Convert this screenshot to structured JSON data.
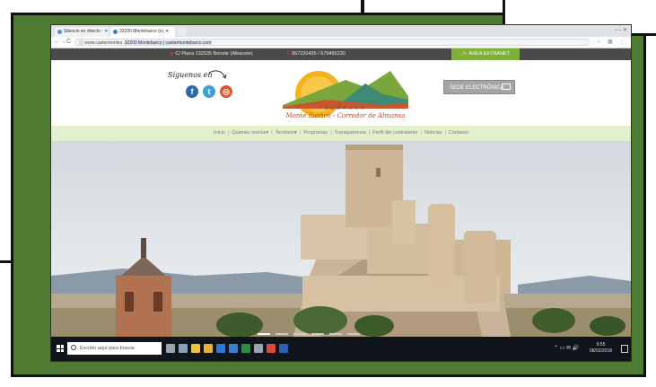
{
  "browser": {
    "tabs": [
      {
        "label": "Silencio en directo · ✕"
      },
      {
        "label": "32200 Montebarco (cc ✕"
      }
    ],
    "nav": {
      "back": "←",
      "forward": "→",
      "reload": "C"
    },
    "url_prefix": "ⓘ www.castermontes",
    "url_selected": "32200 Montebarco | castermontebarco.com"
  },
  "site": {
    "address": "C/ Plaza 132535 Bonete (Albacete)",
    "phone": "967220435 / 679465230",
    "extranet_label": "ÁREA EXTRANET",
    "follow_label": "Síguenos en",
    "social": [
      {
        "icon": "facebook-icon",
        "glyph": "f",
        "color": "#2a6bb0"
      },
      {
        "icon": "twitter-icon",
        "glyph": "t",
        "color": "#3aa0d8"
      },
      {
        "icon": "instagram-icon",
        "glyph": "◎",
        "color": "#d8562f"
      }
    ],
    "logo_org": "COMARCA",
    "logo_name": "Monte Ibérico - Corredor de Almansa",
    "sede_label": "SEDE ELECTRÓNICA"
  },
  "menu": [
    "Inicio",
    "Quienes somos▾",
    "Territorio▾",
    "Programas",
    "Transparencia",
    "Perfil del contratante",
    "Noticias",
    "Contacto"
  ],
  "taskbar": {
    "search_placeholder": "Escribir aquí para buscar",
    "apps": [
      {
        "icon": "mic-icon",
        "color": "#9aa5b1"
      },
      {
        "icon": "task-view-icon",
        "color": "#8aa0b6"
      },
      {
        "icon": "store-icon",
        "color": "#e8c33b"
      },
      {
        "icon": "folder-icon",
        "color": "#e8b23b"
      },
      {
        "icon": "edge-icon",
        "color": "#2a7ad6"
      },
      {
        "icon": "mail-icon",
        "color": "#3a82c8"
      },
      {
        "icon": "excel-icon",
        "color": "#2e8b45"
      },
      {
        "icon": "files-icon",
        "color": "#9aa5b1"
      },
      {
        "icon": "chrome-icon",
        "color": "#d84a3a"
      },
      {
        "icon": "word-icon",
        "color": "#2b5fb4"
      }
    ],
    "time": "9:55",
    "date": "08/02/2018"
  },
  "colors": {
    "frame_green": "#4e7a32",
    "topbar": "#4a4a4a",
    "extranet": "#7fb03a",
    "menu_bg": "#e3f0cd",
    "taskbar": "#10151c"
  }
}
